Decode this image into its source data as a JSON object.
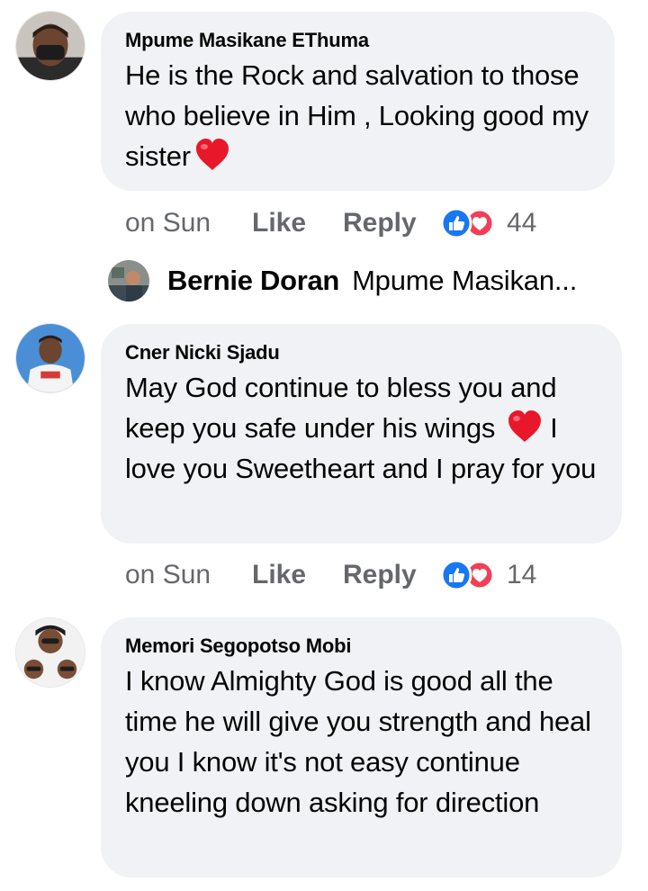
{
  "comments": [
    {
      "author": "Mpume Masikane EThuma",
      "text": "He is the Rock and salvation to those who believe in Him , Looking good my sister",
      "time": "on Sun",
      "like_label": "Like",
      "reply_label": "Reply",
      "reaction_count": "44"
    },
    {
      "author": "Cner Nicki Sjadu",
      "text_before_heart": "May God continue to bless you and keep you safe under his wings",
      "text_after_heart": "I love you Sweetheart and I pray for you",
      "time": "on Sun",
      "like_label": "Like",
      "reply_label": "Reply",
      "reaction_count": "14"
    },
    {
      "author": "Memori Segopotso Mobi",
      "text": "I know Almighty God is good all the time he will give you strength and heal you I know it's not easy continue kneeling down asking for direction"
    }
  ],
  "reply_preview": {
    "author": "Bernie Doran",
    "snippet": "Mpume Masikan..."
  },
  "icons": {
    "like": "thumbs-up-icon",
    "love": "heart-icon",
    "emoji": "red-heart-emoji"
  },
  "colors": {
    "bubble_bg": "#f0f2f5",
    "meta_text": "#65676b",
    "like_blue": "#1877f2",
    "love_red": "#f33e58"
  }
}
